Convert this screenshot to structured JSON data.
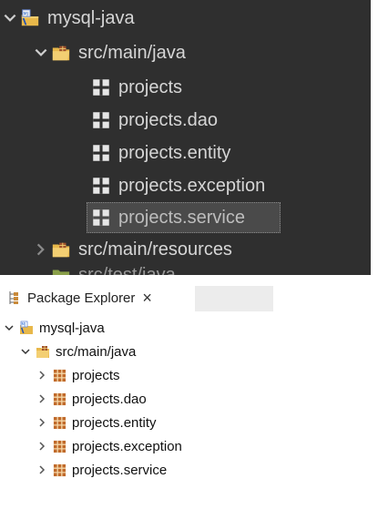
{
  "zoom_view": {
    "project": {
      "label": "mysql-java",
      "icon": "java-project-icon"
    },
    "source_folder": {
      "label": "src/main/java",
      "icon": "source-folder-icon"
    },
    "packages": [
      {
        "label": "projects",
        "icon": "package-icon"
      },
      {
        "label": "projects.dao",
        "icon": "package-icon"
      },
      {
        "label": "projects.entity",
        "icon": "package-icon"
      },
      {
        "label": "projects.exception",
        "icon": "package-icon"
      },
      {
        "label": "projects.service",
        "icon": "package-icon",
        "selected": true
      }
    ],
    "resources_folder": {
      "label": "src/main/resources",
      "icon": "source-folder-icon"
    },
    "partial_row_label": "src/test/java"
  },
  "explorer": {
    "tab_title": "Package Explorer",
    "tab_close": "×",
    "project": {
      "label": "mysql-java"
    },
    "source_folder": {
      "label": "src/main/java"
    },
    "packages": [
      {
        "label": "projects"
      },
      {
        "label": "projects.dao"
      },
      {
        "label": "projects.entity"
      },
      {
        "label": "projects.exception"
      },
      {
        "label": "projects.service"
      }
    ]
  },
  "colors": {
    "dark_bg": "#2f2f2f",
    "dark_text": "#d6d6d6",
    "package_brown": "#a0522d",
    "folder_yellow": "#e8b84a"
  }
}
